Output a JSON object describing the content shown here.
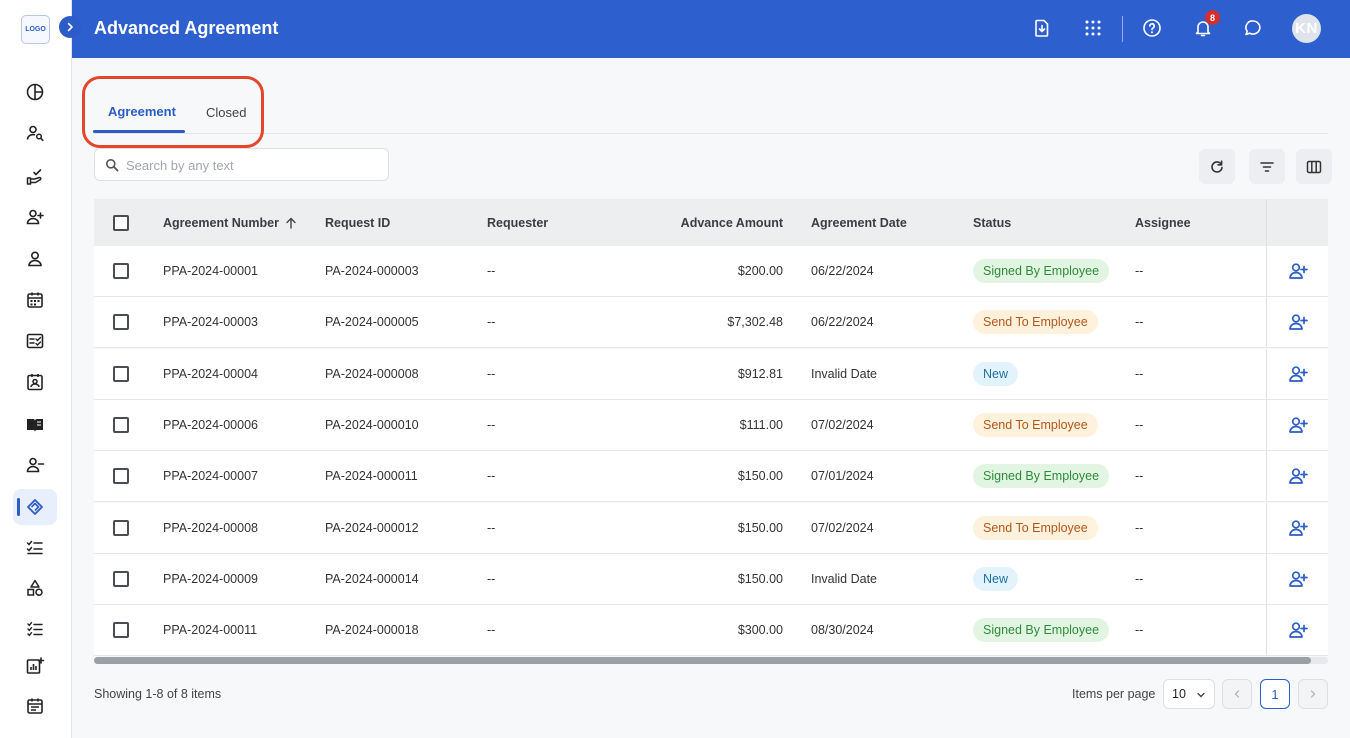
{
  "app": {
    "logo_text": "LOGO",
    "title": "Advanced Agreement"
  },
  "header": {
    "notification_count": "8",
    "avatar_initials": "KN"
  },
  "tabs": [
    {
      "label": "Agreement",
      "active": true
    },
    {
      "label": "Closed",
      "active": false
    }
  ],
  "search": {
    "placeholder": "Search by any text",
    "value": ""
  },
  "table": {
    "columns": [
      "Agreement Number",
      "Request ID",
      "Requester",
      "Advance Amount",
      "Agreement Date",
      "Status",
      "Assignee"
    ],
    "sort": {
      "column": "Agreement Number",
      "direction": "ascending"
    },
    "rows": [
      {
        "agreement_number": "PPA-2024-00001",
        "request_id": "PA-2024-000003",
        "requester": "--",
        "advance_amount": "$200.00",
        "agreement_date": "06/22/2024",
        "status": "Signed By Employee",
        "assignee": "--"
      },
      {
        "agreement_number": "PPA-2024-00003",
        "request_id": "PA-2024-000005",
        "requester": "--",
        "advance_amount": "$7,302.48",
        "agreement_date": "06/22/2024",
        "status": "Send To Employee",
        "assignee": "--"
      },
      {
        "agreement_number": "PPA-2024-00004",
        "request_id": "PA-2024-000008",
        "requester": "--",
        "advance_amount": "$912.81",
        "agreement_date": "Invalid Date",
        "status": "New",
        "assignee": "--"
      },
      {
        "agreement_number": "PPA-2024-00006",
        "request_id": "PA-2024-000010",
        "requester": "--",
        "advance_amount": "$111.00",
        "agreement_date": "07/02/2024",
        "status": "Send To Employee",
        "assignee": "--"
      },
      {
        "agreement_number": "PPA-2024-00007",
        "request_id": "PA-2024-000011",
        "requester": "--",
        "advance_amount": "$150.00",
        "agreement_date": "07/01/2024",
        "status": "Signed By Employee",
        "assignee": "--"
      },
      {
        "agreement_number": "PPA-2024-00008",
        "request_id": "PA-2024-000012",
        "requester": "--",
        "advance_amount": "$150.00",
        "agreement_date": "07/02/2024",
        "status": "Send To Employee",
        "assignee": "--"
      },
      {
        "agreement_number": "PPA-2024-00009",
        "request_id": "PA-2024-000014",
        "requester": "--",
        "advance_amount": "$150.00",
        "agreement_date": "Invalid Date",
        "status": "New",
        "assignee": "--"
      },
      {
        "agreement_number": "PPA-2024-00011",
        "request_id": "PA-2024-000018",
        "requester": "--",
        "advance_amount": "$300.00",
        "agreement_date": "08/30/2024",
        "status": "Signed By Employee",
        "assignee": "--"
      }
    ]
  },
  "footer": {
    "showing": "Showing 1-8 of 8 items",
    "items_per_page_label": "Items per page",
    "items_per_page_value": "10",
    "current_page": "1"
  },
  "colors": {
    "header_bg": "#2e5fcf",
    "accent": "#2b5cc8",
    "highlight_outline": "#e5452a",
    "status_signed": "#2e8b3a",
    "status_send": "#b4561a",
    "status_new": "#1f6fa3"
  },
  "icons": {
    "header": [
      "download-file-icon",
      "apps-grid-icon",
      "help-icon",
      "bell-icon",
      "chat-icon"
    ],
    "sidebar": [
      "pie-chart-icon",
      "person-search-icon",
      "hand-check-icon",
      "person-add-icon",
      "person-icon",
      "calendar-grid-icon",
      "checklist-card-icon",
      "contact-badge-icon",
      "book-icon",
      "person-remove-icon",
      "handshake-icon",
      "task-list-icon",
      "shapes-icon",
      "checklist-icon",
      "analytics-add-icon",
      "event-note-icon"
    ],
    "toolbar": [
      "refresh-icon",
      "filter-icon",
      "columns-icon"
    ],
    "row_action": "assign-person-icon"
  }
}
